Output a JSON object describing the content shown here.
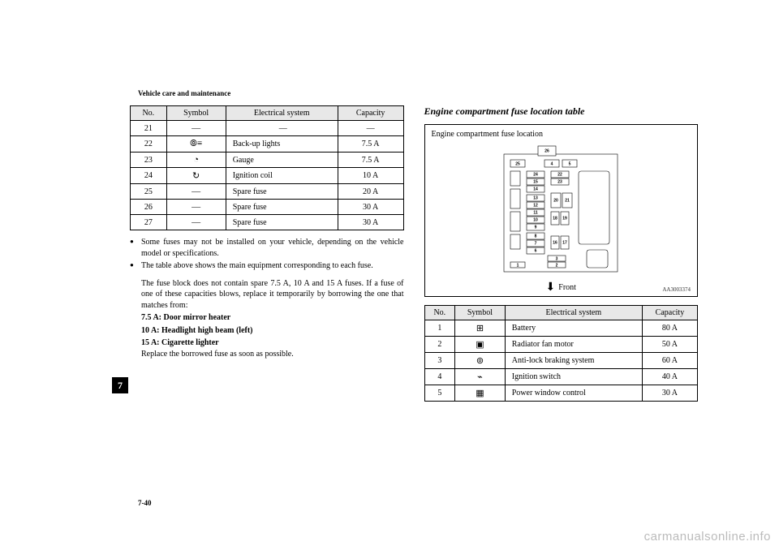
{
  "header": "Vehicle care and maintenance",
  "page_number": "7-40",
  "chapter_tab": "7",
  "watermark": "carmanualsonline.info",
  "left_table": {
    "headers": [
      "No.",
      "Symbol",
      "Electrical system",
      "Capacity"
    ],
    "rows": [
      {
        "no": "21",
        "symbol": "—",
        "system": "—",
        "capacity": "—"
      },
      {
        "no": "22",
        "symbol": "⦾≡",
        "system": "Back-up lights",
        "capacity": "7.5 A"
      },
      {
        "no": "23",
        "symbol": "◔",
        "system": "Gauge",
        "capacity": "7.5 A"
      },
      {
        "no": "24",
        "symbol": "↻",
        "system": "Ignition coil",
        "capacity": "10 A"
      },
      {
        "no": "25",
        "symbol": "—",
        "system": "Spare fuse",
        "capacity": "20 A"
      },
      {
        "no": "26",
        "symbol": "—",
        "system": "Spare fuse",
        "capacity": "30 A"
      },
      {
        "no": "27",
        "symbol": "—",
        "system": "Spare fuse",
        "capacity": "30 A"
      }
    ]
  },
  "notes": {
    "b1": "Some fuses may not be installed on your vehicle, depending on the vehicle model or specifications.",
    "b2": "The table above shows the main equipment corresponding to each fuse.",
    "b2a": "The fuse block does not contain spare 7.5 A, 10 A and 15 A fuses. If a fuse of one of these capacities blows, replace it temporarily by borrowing the one that matches from:",
    "f1": "7.5 A: Door mirror heater",
    "f2": "10 A: Headlight high beam (left)",
    "f3": "15 A: Cigarette lighter",
    "end": "Replace the borrowed fuse as soon as possible."
  },
  "right": {
    "heading": "Engine compartment fuse location table",
    "diagram_label": "Engine compartment fuse location",
    "front_label": "Front",
    "ref": "AA3003374"
  },
  "right_table": {
    "headers": [
      "No.",
      "Symbol",
      "Electrical system",
      "Capacity"
    ],
    "rows": [
      {
        "no": "1",
        "symbol": "⊞",
        "system": "Battery",
        "capacity": "80 A"
      },
      {
        "no": "2",
        "symbol": "▣",
        "system": "Radiator fan motor",
        "capacity": "50 A"
      },
      {
        "no": "3",
        "symbol": "⊚",
        "system": "Anti-lock braking system",
        "capacity": "60 A"
      },
      {
        "no": "4",
        "symbol": "⌁",
        "system": "Ignition switch",
        "capacity": "40 A"
      },
      {
        "no": "5",
        "symbol": "▦",
        "system": "Power window control",
        "capacity": "30 A"
      }
    ]
  },
  "fuse_labels": [
    "1",
    "2",
    "3",
    "4",
    "5",
    "6",
    "7",
    "8",
    "9",
    "10",
    "11",
    "12",
    "13",
    "14",
    "15",
    "16",
    "17",
    "18",
    "19",
    "20",
    "21",
    "22",
    "23",
    "24",
    "25",
    "26"
  ]
}
